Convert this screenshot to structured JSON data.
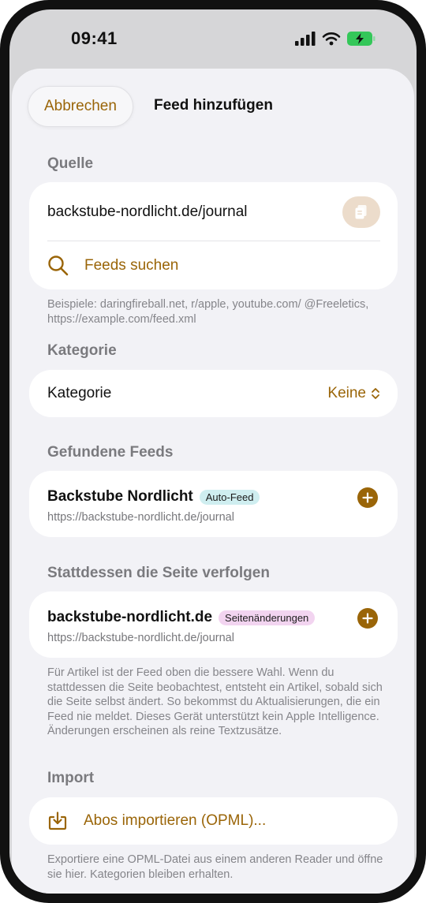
{
  "status_bar": {
    "time": "09:41"
  },
  "header": {
    "cancel_label": "Abbrechen",
    "title": "Feed hinzufügen"
  },
  "source": {
    "section_label": "Quelle",
    "url_value": "backstube-nordlicht.de/journal",
    "search_label": "Feeds suchen",
    "hint": "Beispiele: daringfireball.net, r/apple, youtube.com/ @Freeletics, https://example.com/feed.xml"
  },
  "category": {
    "section_label": "Kategorie",
    "row_label": "Kategorie",
    "value": "Keine"
  },
  "found_feeds": {
    "section_label": "Gefundene Feeds",
    "items": [
      {
        "title": "Backstube Nordlicht",
        "badge": "Auto-Feed",
        "url": "https://backstube-nordlicht.de/journal"
      }
    ]
  },
  "follow_page": {
    "section_label": "Stattdessen die Seite verfolgen",
    "item": {
      "title": "backstube-nordlicht.de",
      "badge": "Seitenänderungen",
      "url": "https://backstube-nordlicht.de/journal"
    },
    "hint": "Für Artikel ist der Feed oben die bessere Wahl. Wenn du stattdessen die Seite beobachtest, entsteht ein Artikel, sobald sich die Seite selbst ändert. So bekommst du Aktualisierungen, die ein Feed nie meldet. Dieses Gerät unterstützt kein Apple Intelligence. Änderungen erscheinen als reine Textzusätze."
  },
  "import": {
    "section_label": "Import",
    "button_label": "Abos importieren (OPML)...",
    "hint": "Exportiere eine OPML-Datei aus einem anderen Reader und öffne sie hier. Kategorien bleiben erhalten."
  },
  "colors": {
    "accent": "#9a6508",
    "sheet_bg": "#f2f2f6",
    "card_bg": "#ffffff",
    "battery": "#34c759"
  },
  "icons": {
    "paste": "clipboard-icon",
    "search": "magnifier-icon",
    "chevron": "chevron-up-down-icon",
    "add": "plus-circle-icon",
    "import": "tray-arrow-down-icon"
  }
}
